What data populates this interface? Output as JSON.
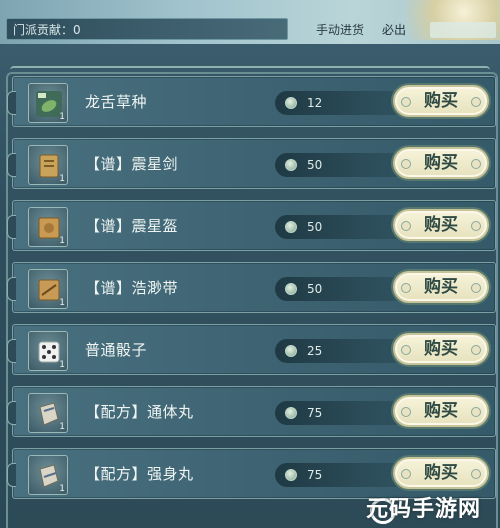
{
  "header": {
    "contribution_text": "门派贡献：0",
    "tabs": [
      {
        "label": "手动进货"
      },
      {
        "label": "必出"
      }
    ]
  },
  "items": [
    {
      "icon": "seed-icon",
      "name": "龙舌草种",
      "price": "12",
      "qty": "1",
      "buy_label": "购买"
    },
    {
      "icon": "recipe-scroll-icon",
      "name": "【谱】震星剑",
      "price": "50",
      "qty": "1",
      "buy_label": "购买"
    },
    {
      "icon": "recipe-scroll-icon",
      "name": "【谱】震星盔",
      "price": "50",
      "qty": "1",
      "buy_label": "购买"
    },
    {
      "icon": "recipe-scroll-icon",
      "name": "【谱】浩渺带",
      "price": "50",
      "qty": "1",
      "buy_label": "购买"
    },
    {
      "icon": "dice-icon",
      "name": "普通骰子",
      "price": "25",
      "qty": "1",
      "buy_label": "购买"
    },
    {
      "icon": "recipe-paper-icon",
      "name": "【配方】通体丸",
      "price": "75",
      "qty": "1",
      "buy_label": "购买"
    },
    {
      "icon": "recipe-paper-icon",
      "name": "【配方】强身丸",
      "price": "75",
      "qty": "1",
      "buy_label": "购买"
    }
  ],
  "watermark": {
    "text": "元码手游网"
  }
}
